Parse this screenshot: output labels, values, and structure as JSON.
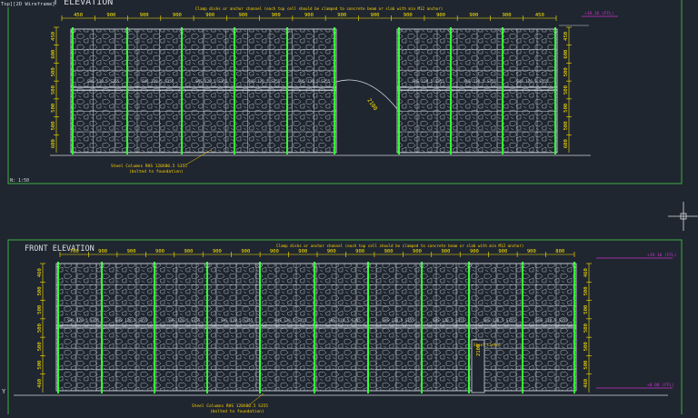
{
  "viewport_label": "Top][2D Wireframe]",
  "colors": {
    "background": "#1f2630",
    "frame": "#3fae3f",
    "column": "#33ff33",
    "dimension": "#ffe600",
    "note": "#ffd000",
    "level": "#cc33cc",
    "panel": "#cfd5dc"
  },
  "left_elevation": {
    "title": "LEFT ELEVATION",
    "scale": "N: 1:50",
    "note_top": "Clamp disks or anchor channel (each top cell should be clamped to concrete beam or slab with min M12 anchor)",
    "note_columns_line1": "Steel Columns RHS 120X80.5 S355",
    "note_columns_line2": "(bolted to foundation)",
    "level_top": "+18.10 (FFL)",
    "door_dim": "2100",
    "top_dims": [
      "450",
      "900",
      "900",
      "900",
      "900",
      "900",
      "900",
      "900",
      "900",
      "900",
      "900",
      "900",
      "900",
      "900",
      "450"
    ],
    "beam_label": "SHS 120.5 S355",
    "side_dims": [
      "450",
      "600",
      "500",
      "500",
      "500",
      "500",
      "600"
    ]
  },
  "front_elevation": {
    "title": "FRONT ELEVATION",
    "note_top": "Clamp disks or anchor channel (each top cell should be clamped to concrete beam or slab with min M12 anchor)",
    "note_columns_line1": "Steel Columns RHS 120X80.5 S355",
    "note_columns_line2": "(bolted to foundation)",
    "level_top": "+19.10 (FFL)",
    "level_bottom": "+0.00 (FFL)",
    "door_label": "Steel Lintel",
    "door_dim": "2100",
    "top_dims": [
      "700",
      "900",
      "900",
      "900",
      "900",
      "900",
      "900",
      "900",
      "900",
      "900",
      "900",
      "900",
      "900",
      "900",
      "900",
      "900",
      "900",
      "800"
    ],
    "beam_label": "SHS 120.5 S355",
    "side_dims": [
      "460",
      "500",
      "500",
      "500",
      "500",
      "500",
      "460"
    ]
  },
  "axis_label": "Y"
}
